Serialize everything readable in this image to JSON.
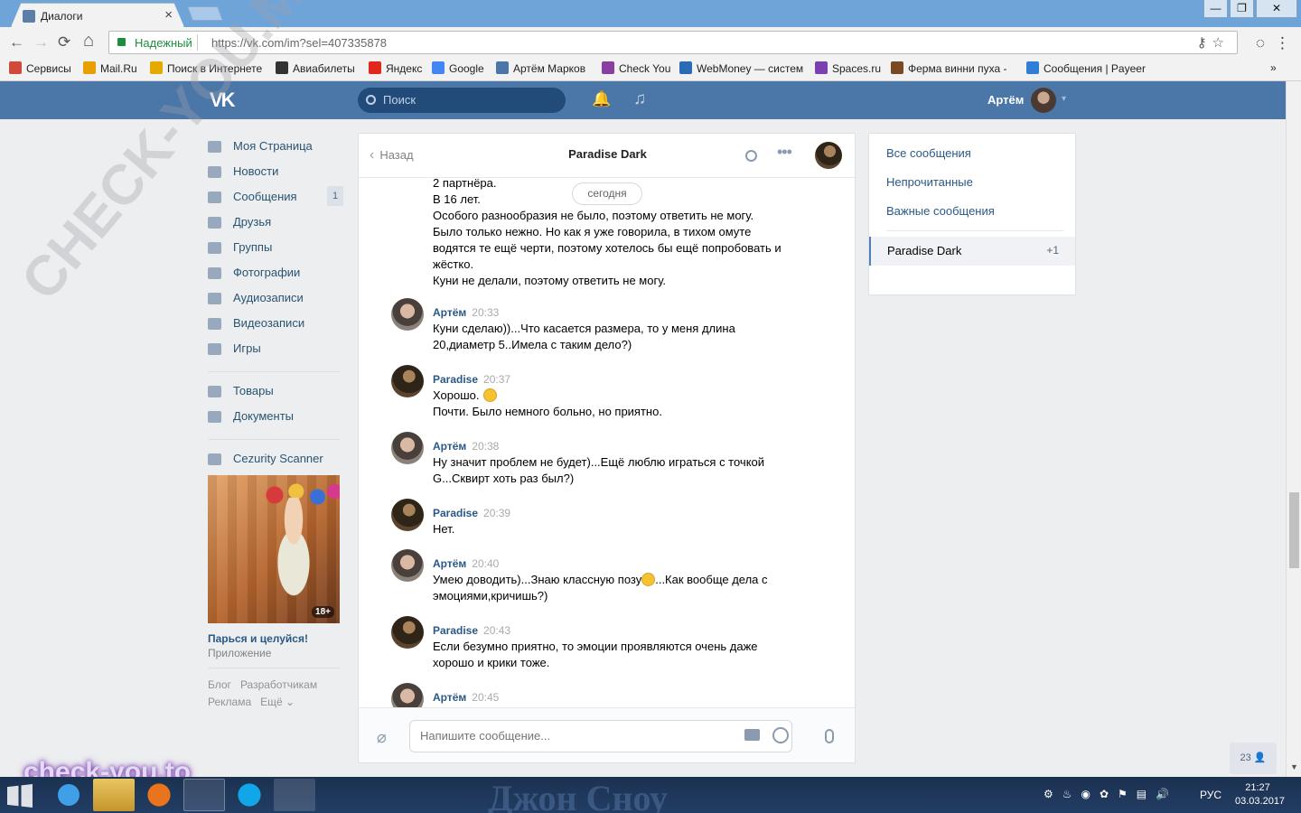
{
  "browser": {
    "tab_title": "Диалоги",
    "tab_close": "×",
    "win_buttons": [
      "—",
      "❐",
      "✕"
    ],
    "nav_back": "←",
    "nav_forward": "→",
    "nav_reload": "⟳",
    "nav_home": "⌂",
    "secure_label": "Надежный",
    "url": "https://vk.com/im?sel=407335878",
    "omni_icons": "⚷☆",
    "ext_icon": "◌",
    "menu_icon": "⋮",
    "bookmarks": [
      {
        "label": "Сервисы",
        "color": "#d04a3a"
      },
      {
        "label": "Mail.Ru",
        "color": "#e8a000"
      },
      {
        "label": "Поиск в Интернете",
        "color": "#e6a900"
      },
      {
        "label": "Авиабилеты",
        "color": "#333333"
      },
      {
        "label": "Яндекс",
        "color": "#e0281d"
      },
      {
        "label": "Google",
        "color": "#4285f4"
      },
      {
        "label": "Артём Марков",
        "color": "#4a76a8"
      },
      {
        "label": "Check You",
        "color": "#8a3fa0"
      },
      {
        "label": "WebMoney — систем",
        "color": "#2a6bb5"
      },
      {
        "label": "Spaces.ru",
        "color": "#7a3fb0"
      },
      {
        "label": "Ферма винни пуха -",
        "color": "#7a4a22"
      },
      {
        "label": "Сообщения | Payeer",
        "color": "#2f7fd6"
      }
    ],
    "bookmarks_more": "»"
  },
  "vk": {
    "logo": "VK",
    "search_placeholder": "Поиск",
    "bell_icon": "🔔",
    "music_icon": "♫",
    "user_name": "Артём",
    "user_caret": "▾"
  },
  "sidebar": {
    "items": [
      {
        "label": "Моя Страница"
      },
      {
        "label": "Новости"
      },
      {
        "label": "Сообщения",
        "badge": "1"
      },
      {
        "label": "Друзья"
      },
      {
        "label": "Группы"
      },
      {
        "label": "Фотографии"
      },
      {
        "label": "Аудиозаписи"
      },
      {
        "label": "Видеозаписи"
      },
      {
        "label": "Игры"
      }
    ],
    "items2": [
      {
        "label": "Товары"
      },
      {
        "label": "Документы"
      }
    ],
    "items3": [
      {
        "label": "Cezurity Scanner"
      }
    ],
    "ad": {
      "age": "18+",
      "title": "Парься и целуйся!",
      "subtitle": "Приложение"
    },
    "footer": {
      "blog": "Блог",
      "dev": "Разработчикам",
      "ads": "Реклама",
      "more": "Ещё ⌄"
    }
  },
  "chat": {
    "back_arrow": "‹",
    "back_label": "Назад",
    "title": "Paradise Dark",
    "dots": "•••",
    "today": "сегодня",
    "first_block": [
      "2 партнёра.",
      "В 16 лет.",
      "Особого разнообразия не было, поэтому ответить не могу.",
      "Было только нежно. Но как я уже говорила, в тихом омуте",
      "водятся те ещё черти, поэтому хотелось бы ещё попробовать и",
      "жёстко.",
      "Куни не делали, поэтому ответить не могу."
    ],
    "messages": [
      {
        "author": "Артём",
        "time": "20:33",
        "lines": [
          "Куни сделаю))...Что касается размера, то у меня длина",
          "20,диаметр 5..Имела с таким дело?)"
        ]
      },
      {
        "author": "Paradise",
        "time": "20:37",
        "lines": [
          "Хорошо.",
          "Почти. Было немного больно, но приятно."
        ]
      },
      {
        "author": "Артём",
        "time": "20:38",
        "lines": [
          "Ну значит проблем не будет)...Ещё люблю играться с точкой",
          "G...Сквирт хоть раз был?)"
        ]
      },
      {
        "author": "Paradise",
        "time": "20:39",
        "lines": [
          "Нет."
        ]
      },
      {
        "author": "Артём",
        "time": "20:40",
        "lines": [
          "Умею доводить)...Знаю классную позу",
          "...Как вообще дела с",
          "эмоциями,кричишь?)"
        ]
      },
      {
        "author": "Paradise",
        "time": "20:43",
        "lines": [
          "Если безумно приятно, то эмоции проявляются очень даже",
          "хорошо и крики тоже."
        ]
      },
      {
        "author": "Артём",
        "time": "20:45",
        "lines": []
      }
    ],
    "input_placeholder": "Напишите сообщение..."
  },
  "filters": {
    "all": "Все сообщения",
    "unread": "Непрочитанные",
    "important": "Важные сообщения",
    "active_name": "Paradise Dark",
    "active_count": "+1"
  },
  "online_count": "23 👤",
  "watermark": {
    "diag": "CHECK-YOU.ME",
    "bottom": "check-you.to"
  },
  "taskbar": {
    "bg_text": "Джон Сноу",
    "tray_icons": "⚙♨◉✿⚑▤🔊",
    "lang": "РУС",
    "time": "21:27",
    "date": "03.03.2017"
  },
  "colors": {
    "vk_blue": "#4a76a8",
    "link": "#2a5885"
  }
}
